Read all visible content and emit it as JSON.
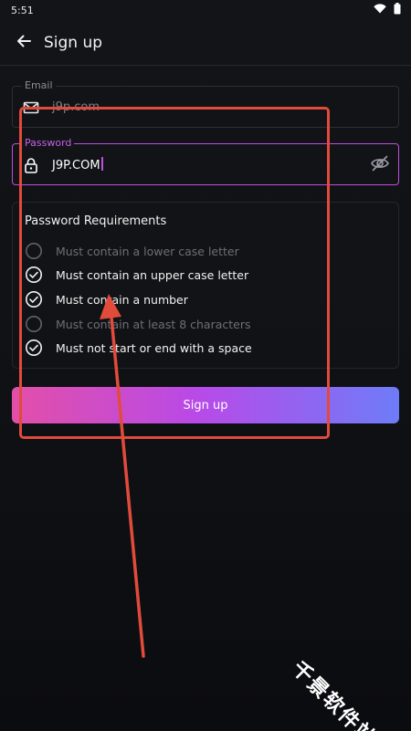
{
  "status_bar": {
    "time": "5:51",
    "wifi_icon": "wifi-icon",
    "battery_icon": "battery-icon"
  },
  "app_bar": {
    "title": "Sign up",
    "back_icon": "arrow-left-icon"
  },
  "email": {
    "label": "Email",
    "value": "j9p.com",
    "icon": "mail-icon"
  },
  "password": {
    "label": "Password",
    "value": "J9P.COM",
    "icon": "lock-icon",
    "toggle_icon": "eye-off-icon"
  },
  "requirements": {
    "title": "Password Requirements",
    "items": [
      {
        "label": "Must contain a lower case letter",
        "met": false
      },
      {
        "label": "Must contain an upper case letter",
        "met": true
      },
      {
        "label": "Must contain a number",
        "met": true
      },
      {
        "label": "Must contain at least 8 characters",
        "met": false
      },
      {
        "label": "Must not start or end with a space",
        "met": true
      }
    ]
  },
  "signup_button": {
    "label": "Sign up"
  },
  "watermark": {
    "text": "千景软件站"
  },
  "colors": {
    "accent_purple": "#c04ee0",
    "annotation_red": "#e14b3b",
    "gradient_start": "#e24fa8",
    "gradient_mid": "#b84ae8",
    "gradient_end": "#6e7cf8"
  }
}
